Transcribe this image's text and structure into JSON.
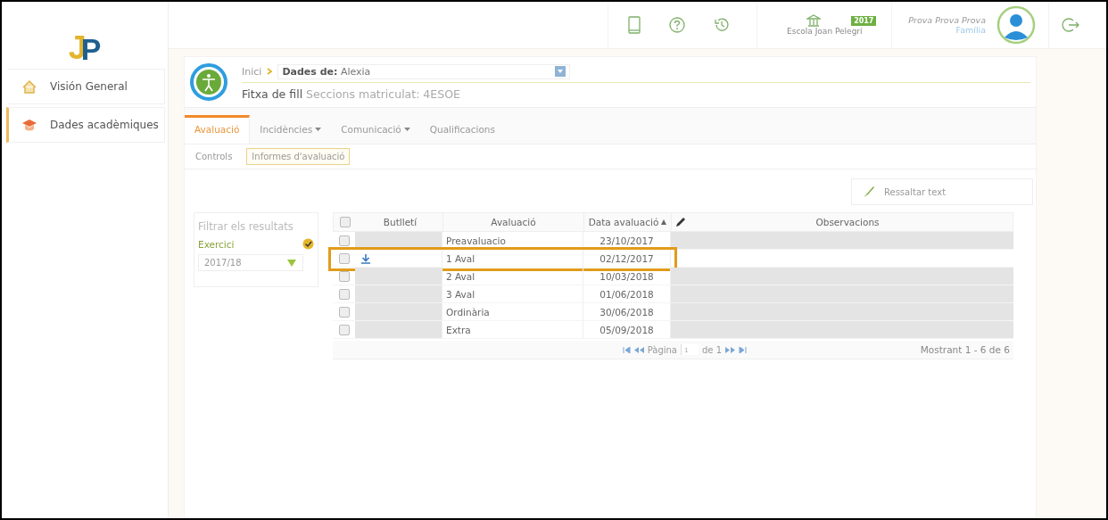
{
  "logo": {
    "letters": [
      "J",
      "P"
    ]
  },
  "sidebar": {
    "items": [
      {
        "label": "Visión General",
        "selected": false
      },
      {
        "label": "Dades acadèmiques",
        "selected": true
      }
    ]
  },
  "topbar": {
    "school": "Escola Joan Pelegrí",
    "year": "2017",
    "user": "Prova Prova Prova",
    "role": "Família"
  },
  "breadcrumb": {
    "home": "Inici",
    "select_label": "Dades de:",
    "select_value": "Alexia",
    "title": "Fitxa de fill",
    "subtitle": "Seccions matriculat: 4ESOE"
  },
  "tabs": [
    {
      "label": "Avaluació",
      "selected": true,
      "dropdown": false
    },
    {
      "label": "Incidències",
      "selected": false,
      "dropdown": true
    },
    {
      "label": "Comunicació",
      "selected": false,
      "dropdown": true
    },
    {
      "label": "Qualificacions",
      "selected": false,
      "dropdown": false
    }
  ],
  "subtabs": [
    {
      "label": "Controls",
      "selected": false
    },
    {
      "label": "Informes d'avaluació",
      "selected": true
    }
  ],
  "highlight_button": "Ressaltar text",
  "filter": {
    "title": "Filtrar els resultats",
    "field_label": "Exercici",
    "checked": true,
    "value": "2017/18"
  },
  "table": {
    "all_checked": false,
    "columns": [
      "Butlletí",
      "Avaluació",
      "Data avaluació",
      "Observacions"
    ],
    "rows": [
      {
        "avaluacio": "Preavaluacio",
        "data": "23/10/2017",
        "checked": false,
        "download": false,
        "selected": false
      },
      {
        "avaluacio": "1 Aval",
        "data": "02/12/2017",
        "checked": false,
        "download": true,
        "selected": true
      },
      {
        "avaluacio": "2 Aval",
        "data": "10/03/2018",
        "checked": false,
        "download": false,
        "selected": false
      },
      {
        "avaluacio": "3 Aval",
        "data": "01/06/2018",
        "checked": false,
        "download": false,
        "selected": false
      },
      {
        "avaluacio": "Ordinària",
        "data": "30/06/2018",
        "checked": false,
        "download": false,
        "selected": false
      },
      {
        "avaluacio": "Extra",
        "data": "05/09/2018",
        "checked": false,
        "download": false,
        "selected": false
      }
    ],
    "pager": {
      "page_label": "Pàgina",
      "page": "1",
      "of": "de 1",
      "summary": "Mostrant 1 - 6 de 6"
    }
  }
}
